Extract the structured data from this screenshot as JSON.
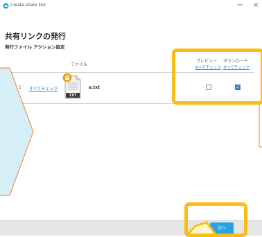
{
  "window": {
    "title": "Create share link",
    "minimize_glyph": "−",
    "close_glyph": "×"
  },
  "page": {
    "title": "共有リンクの発行",
    "section_title": "発行ファイル アクション設定"
  },
  "table": {
    "columns": {
      "file": "ファイル",
      "preview": "プレビュー",
      "download": "ダウンロード"
    },
    "check_all_label": "すべてチェック",
    "rows": [
      {
        "index": "1",
        "check_all": "すべてチェック",
        "file_type": "TXT",
        "file_name": "a.txt",
        "preview_checked": false,
        "download_checked": true
      }
    ]
  },
  "footer": {
    "next_label": "次へ"
  },
  "icons": {
    "app": "cloud-icon",
    "file": "txt-file-icon",
    "badge": "lock-badge-icon"
  },
  "colors": {
    "highlight": "#f9be16",
    "callout_fill": "#d6eef5",
    "callout_stroke": "#ef8233",
    "link": "#2a7ec8",
    "button": "#29a3e0",
    "checkbox_checked": "#2f7fd1"
  }
}
